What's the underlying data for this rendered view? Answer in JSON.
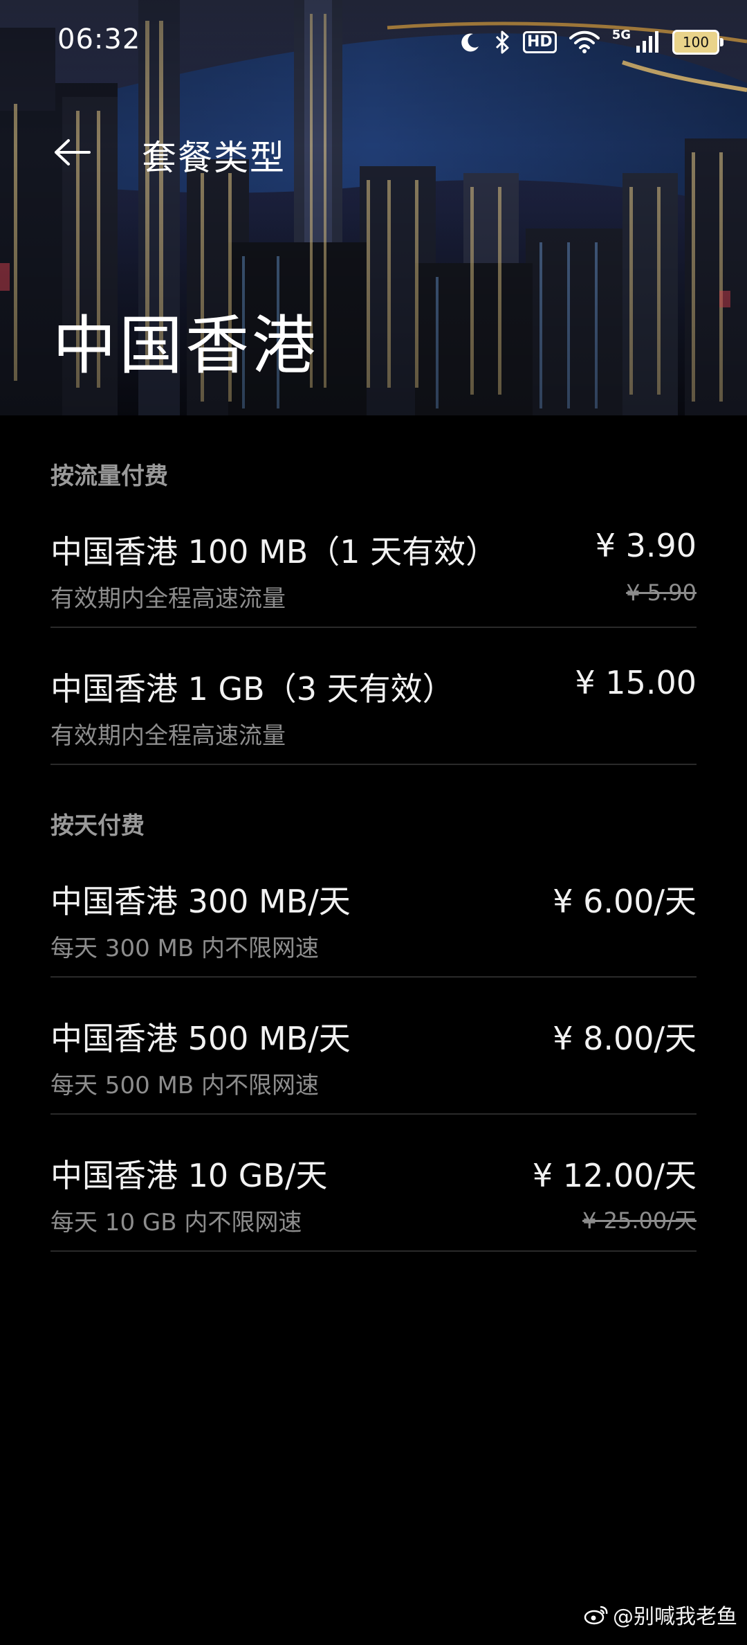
{
  "status_bar": {
    "time": "06:32",
    "icons": [
      "moon-icon",
      "bluetooth-icon",
      "hd-icon",
      "wifi-icon",
      "signal-5g-icon",
      "battery-icon"
    ],
    "hd_label": "HD",
    "network": "5G",
    "battery": "100"
  },
  "header": {
    "back_icon": "arrow-left-icon",
    "title": "套餐类型",
    "region_title": "中国香港"
  },
  "sections": [
    {
      "title": "按流量付费",
      "plans": [
        {
          "name": "中国香港 100 MB（1 天有效）",
          "description": "有效期内全程高速流量",
          "price": "¥ 3.90",
          "original_price": "¥ 5.90"
        },
        {
          "name": "中国香港 1 GB（3 天有效）",
          "description": "有效期内全程高速流量",
          "price": "¥ 15.00",
          "original_price": ""
        }
      ]
    },
    {
      "title": "按天付费",
      "plans": [
        {
          "name": "中国香港 300 MB/天",
          "description": "每天 300 MB 内不限网速",
          "price": "¥ 6.00/天",
          "original_price": ""
        },
        {
          "name": "中国香港 500 MB/天",
          "description": "每天 500 MB 内不限网速",
          "price": "¥ 8.00/天",
          "original_price": ""
        },
        {
          "name": "中国香港 10 GB/天",
          "description": "每天 10 GB 内不限网速",
          "price": "¥ 12.00/天",
          "original_price": "¥ 25.00/天"
        }
      ]
    }
  ],
  "watermark": {
    "icon": "weibo-icon",
    "text": "@别喊我老鱼"
  },
  "colors": {
    "background": "#000000",
    "primary_text": "#f2f2f2",
    "secondary_text": "#8d8d8d",
    "divider": "#2a2a2a"
  }
}
